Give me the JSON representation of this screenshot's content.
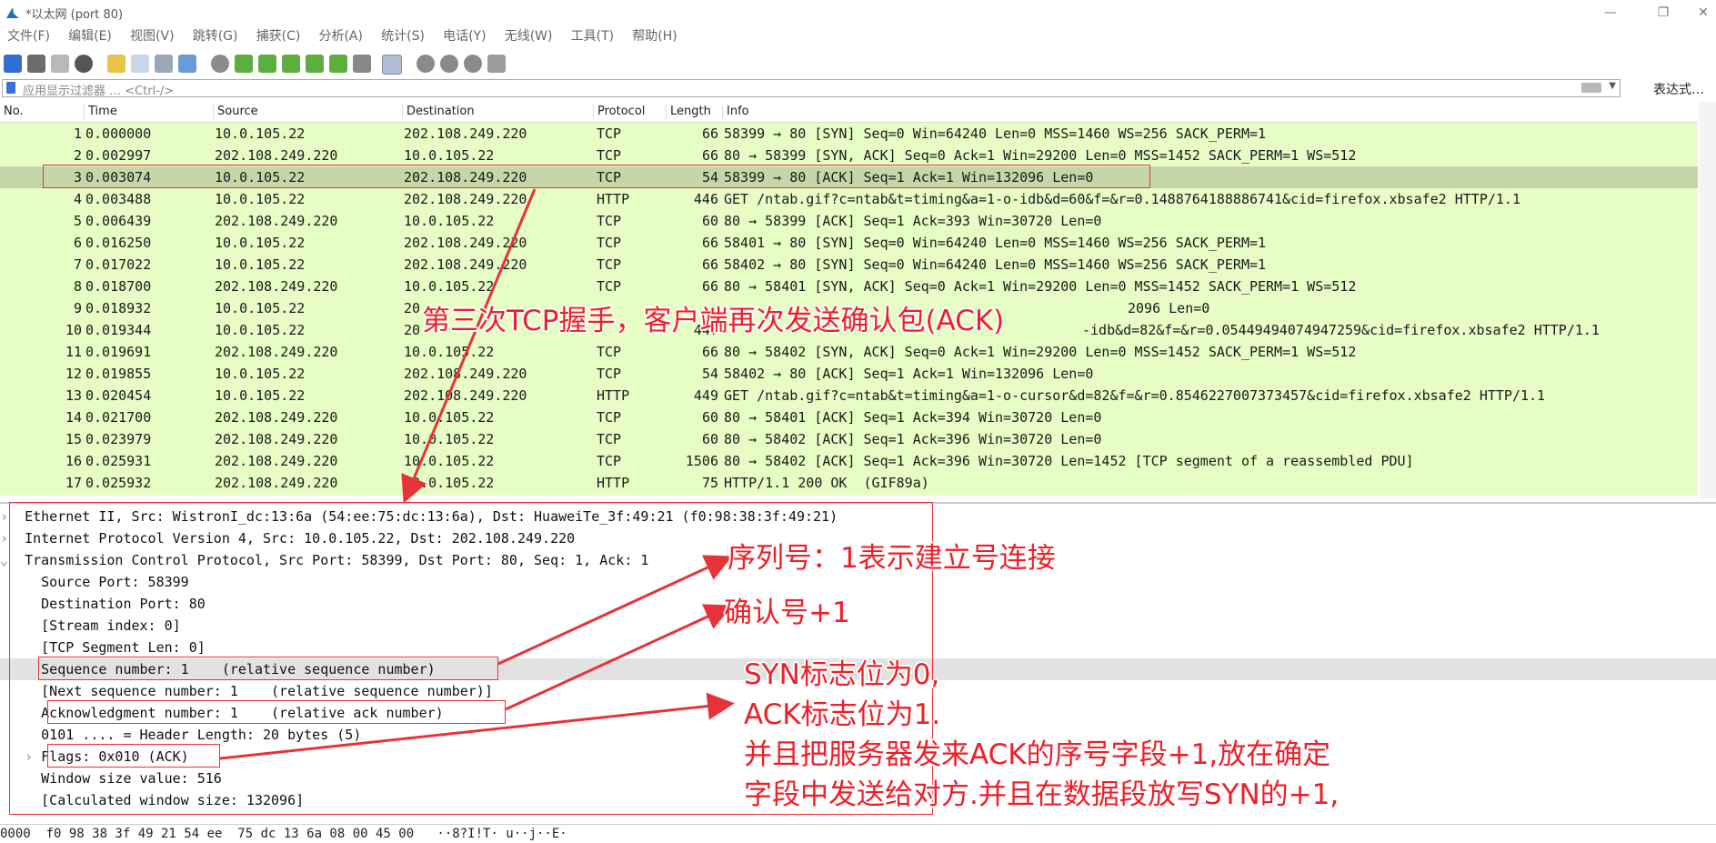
{
  "window": {
    "title": "*以太网 (port 80)"
  },
  "menu": [
    "文件(F)",
    "编辑(E)",
    "视图(V)",
    "跳转(G)",
    "捕获(C)",
    "分析(A)",
    "统计(S)",
    "电话(Y)",
    "无线(W)",
    "工具(T)",
    "帮助(H)"
  ],
  "filter": {
    "placeholder": "应用显示过滤器 … <Ctrl-/>",
    "expression_label": "表达式…"
  },
  "columns": [
    "No.",
    "Time",
    "Source",
    "Destination",
    "Protocol",
    "Length",
    "Info"
  ],
  "packets": [
    {
      "no": "1",
      "time": "0.000000",
      "src": "10.0.105.22",
      "dst": "202.108.249.220",
      "proto": "TCP",
      "len": "66",
      "info": "58399 → 80 [SYN] Seq=0 Win=64240 Len=0 MSS=1460 WS=256 SACK_PERM=1"
    },
    {
      "no": "2",
      "time": "0.002997",
      "src": "202.108.249.220",
      "dst": "10.0.105.22",
      "proto": "TCP",
      "len": "66",
      "info": "80 → 58399 [SYN, ACK] Seq=0 Ack=1 Win=29200 Len=0 MSS=1452 SACK_PERM=1 WS=512"
    },
    {
      "no": "3",
      "time": "0.003074",
      "src": "10.0.105.22",
      "dst": "202.108.249.220",
      "proto": "TCP",
      "len": "54",
      "info": "58399 → 80 [ACK] Seq=1 Ack=1 Win=132096 Len=0"
    },
    {
      "no": "4",
      "time": "0.003488",
      "src": "10.0.105.22",
      "dst": "202.108.249.220",
      "proto": "HTTP",
      "len": "446",
      "info": "GET /ntab.gif?c=ntab&t=timing&a=1-o-idb&d=60&f=&r=0.1488764188886741&cid=firefox.xbsafe2 HTTP/1.1"
    },
    {
      "no": "5",
      "time": "0.006439",
      "src": "202.108.249.220",
      "dst": "10.0.105.22",
      "proto": "TCP",
      "len": "60",
      "info": "80 → 58399 [ACK] Seq=1 Ack=393 Win=30720 Len=0"
    },
    {
      "no": "6",
      "time": "0.016250",
      "src": "10.0.105.22",
      "dst": "202.108.249.220",
      "proto": "TCP",
      "len": "66",
      "info": "58401 → 80 [SYN] Seq=0 Win=64240 Len=0 MSS=1460 WS=256 SACK_PERM=1"
    },
    {
      "no": "7",
      "time": "0.017022",
      "src": "10.0.105.22",
      "dst": "202.108.249.220",
      "proto": "TCP",
      "len": "66",
      "info": "58402 → 80 [SYN] Seq=0 Win=64240 Len=0 MSS=1460 WS=256 SACK_PERM=1"
    },
    {
      "no": "8",
      "time": "0.018700",
      "src": "202.108.249.220",
      "dst": "10.0.105.22",
      "proto": "TCP",
      "len": "66",
      "info": "80 → 58401 [SYN, ACK] Seq=0 Ack=1 Win=29200 Len=0 MSS=1452 SACK_PERM=1 WS=512"
    },
    {
      "no": "9",
      "time": "0.018932",
      "src": "10.0.105.22",
      "dst": "20",
      "proto": "",
      "len": "",
      "info": "2096 Len=0"
    },
    {
      "no": "10",
      "time": "0.019344",
      "src": "10.0.105.22",
      "dst": "20",
      "proto": "",
      "len": "447",
      "info": "-idb&d=82&f=&r=0.05449494074947259&cid=firefox.xbsafe2 HTTP/1.1"
    },
    {
      "no": "11",
      "time": "0.019691",
      "src": "202.108.249.220",
      "dst": "10.0.105.22",
      "proto": "TCP",
      "len": "66",
      "info": "80 → 58402 [SYN, ACK] Seq=0 Ack=1 Win=29200 Len=0 MSS=1452 SACK_PERM=1 WS=512"
    },
    {
      "no": "12",
      "time": "0.019855",
      "src": "10.0.105.22",
      "dst": "202.108.249.220",
      "proto": "TCP",
      "len": "54",
      "info": "58402 → 80 [ACK] Seq=1 Ack=1 Win=132096 Len=0"
    },
    {
      "no": "13",
      "time": "0.020454",
      "src": "10.0.105.22",
      "dst": "202.108.249.220",
      "proto": "HTTP",
      "len": "449",
      "info": "GET /ntab.gif?c=ntab&t=timing&a=1-o-cursor&d=82&f=&r=0.8546227007373457&cid=firefox.xbsafe2 HTTP/1.1"
    },
    {
      "no": "14",
      "time": "0.021700",
      "src": "202.108.249.220",
      "dst": "10.0.105.22",
      "proto": "TCP",
      "len": "60",
      "info": "80 → 58401 [ACK] Seq=1 Ack=394 Win=30720 Len=0"
    },
    {
      "no": "15",
      "time": "0.023979",
      "src": "202.108.249.220",
      "dst": "10.0.105.22",
      "proto": "TCP",
      "len": "60",
      "info": "80 → 58402 [ACK] Seq=1 Ack=396 Win=30720 Len=0"
    },
    {
      "no": "16",
      "time": "0.025931",
      "src": "202.108.249.220",
      "dst": "10.0.105.22",
      "proto": "TCP",
      "len": "1506",
      "info": "80 → 58402 [ACK] Seq=1 Ack=396 Win=30720 Len=1452 [TCP segment of a reassembled PDU]"
    },
    {
      "no": "17",
      "time": "0.025932",
      "src": "202.108.249.220",
      "dst": "10.0.105.22",
      "proto": "HTTP",
      "len": "75",
      "info": "HTTP/1.1 200 OK  (GIF89a)"
    }
  ],
  "selected_packet": "3",
  "details": [
    "Ethernet II, Src: WistronI_dc:13:6a (54:ee:75:dc:13:6a), Dst: HuaweiTe_3f:49:21 (f0:98:38:3f:49:21)",
    "Internet Protocol Version 4, Src: 10.0.105.22, Dst: 202.108.249.220",
    "Transmission Control Protocol, Src Port: 58399, Dst Port: 80, Seq: 1, Ack: 1",
    "Source Port: 58399",
    "Destination Port: 80",
    "[Stream index: 0]",
    "[TCP Segment Len: 0]",
    "Sequence number: 1    (relative sequence number)",
    "[Next sequence number: 1    (relative sequence number)]",
    "Acknowledgment number: 1    (relative ack number)",
    "0101 .... = Header Length: 20 bytes (5)",
    "Flags: 0x010 (ACK)",
    "Window size value: 516",
    "[Calculated window size: 132096]"
  ],
  "bytes_line": "0000  f0 98 38 3f 49 21 54 ee  75 dc 13 6a 08 00 45 00   ··8?I!T· u··j··E·",
  "annotations": {
    "third_handshake": "第三次TCP握手，客户端再次发送确认包(ACK)",
    "seq_note": "序列号：1表示建立号连接",
    "ack_note": "确认号+1",
    "flags_note_1": "SYN标志位为0,",
    "flags_note_2": "ACK标志位为1.",
    "flags_note_3": "并且把服务器发来ACK的序号字段+1,放在确定",
    "flags_note_4": "字段中发送给对方.并且在数据段放写SYN的+1,"
  },
  "colors": {
    "packet_bg": "#e6fdc5",
    "selected_row": "#c5d7a9",
    "annotation_red": "#ee1f28"
  }
}
